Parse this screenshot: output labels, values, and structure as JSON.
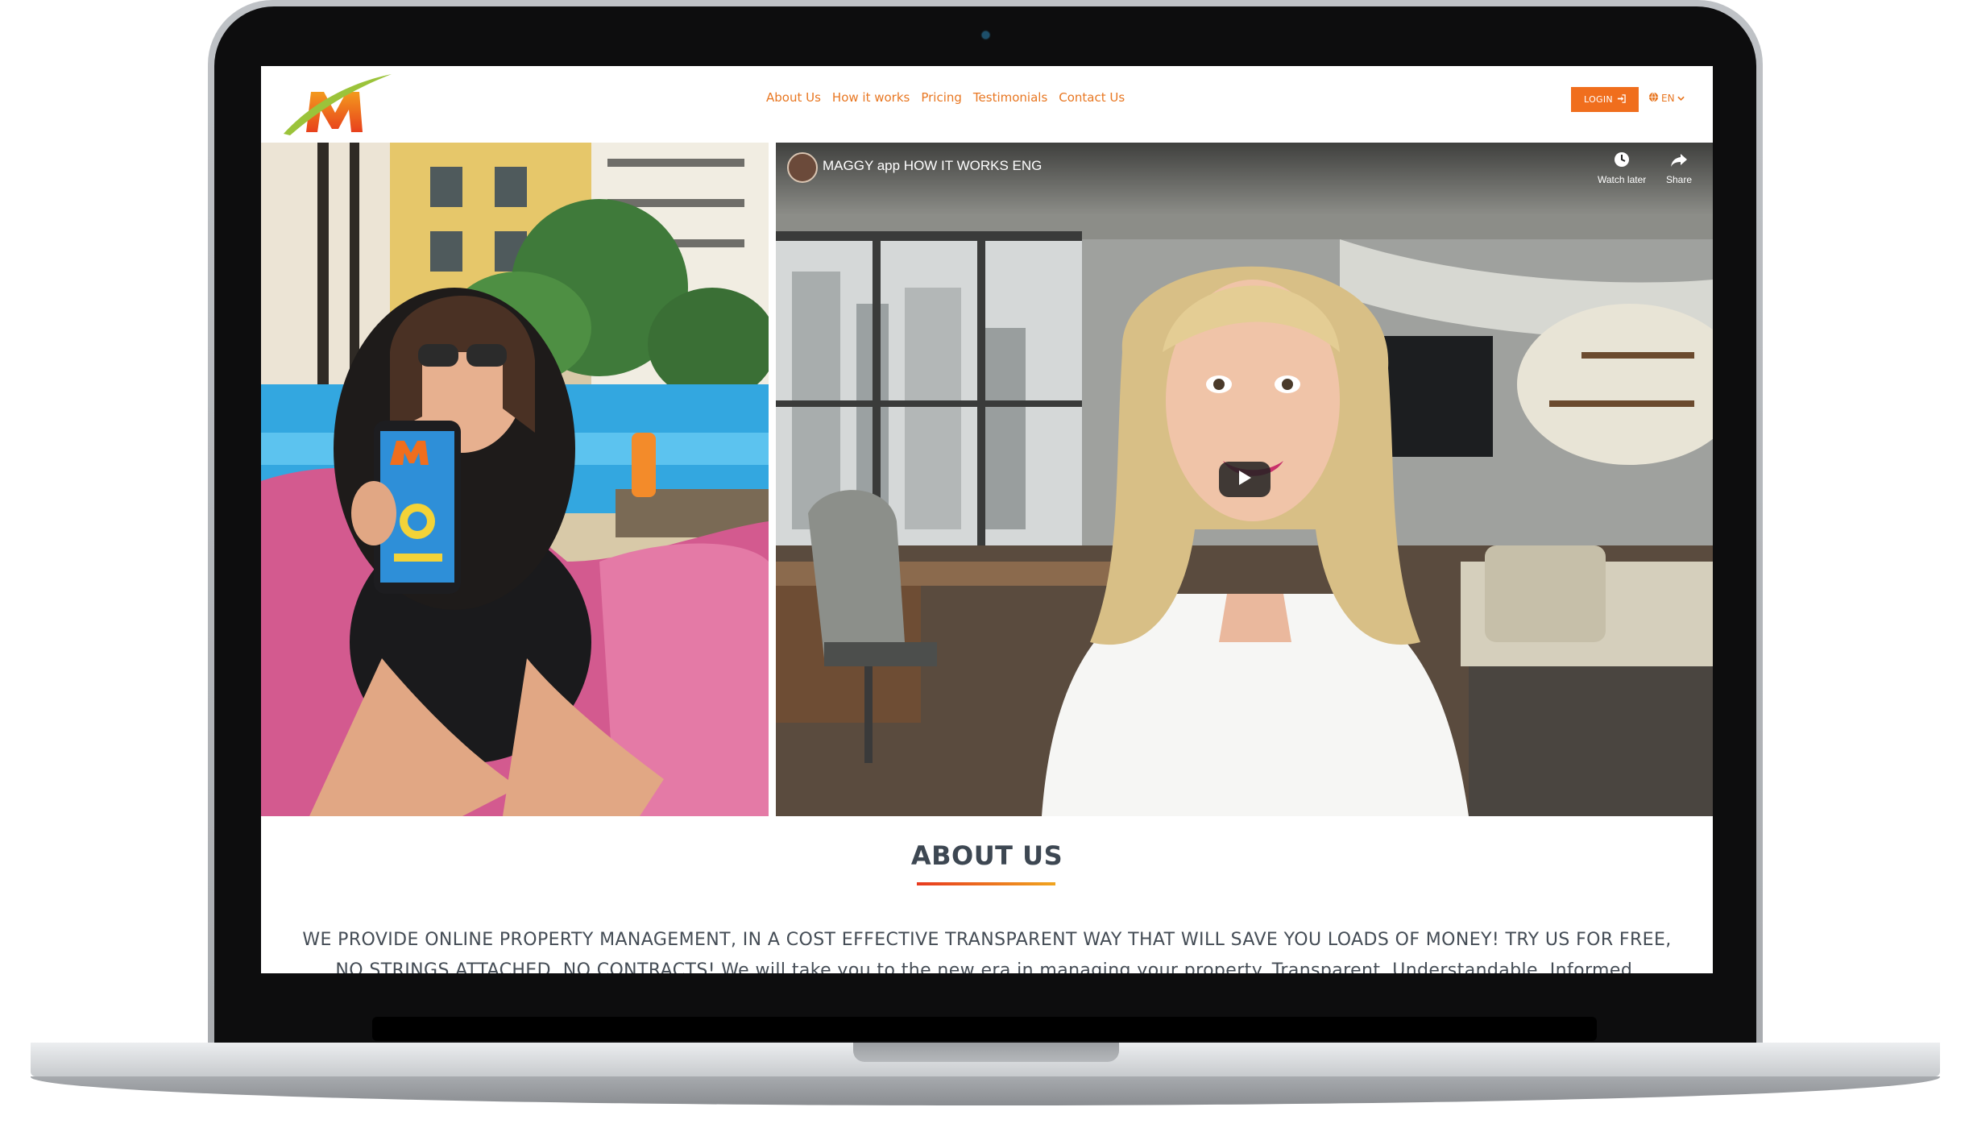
{
  "nav": {
    "items": [
      "About Us",
      "How it works",
      "Pricing",
      "Testimonials",
      "Contact Us"
    ],
    "login_label": "LOGIN",
    "language": "EN"
  },
  "video": {
    "title": "MAGGY app HOW IT WORKS ENG",
    "watch_later": "Watch later",
    "share": "Share"
  },
  "about": {
    "title": "ABOUT US",
    "text": "WE PROVIDE ONLINE PROPERTY MANAGEMENT, IN A COST EFFECTIVE TRANSPARENT WAY THAT WILL SAVE YOU LOADS OF MONEY! TRY US FOR FREE, NO STRINGS ATTACHED, NO CONTRACTS! We will take you to the new era in managing your property. Transparent. Understandable. Informed."
  },
  "colors": {
    "brand_orange": "#f06e1d",
    "nav_text": "#e87722",
    "heading": "#3d4752"
  },
  "icons": [
    "sign-in-icon",
    "globe-icon",
    "chevron-down-icon",
    "clock-icon",
    "share-arrow-icon",
    "play-icon"
  ]
}
